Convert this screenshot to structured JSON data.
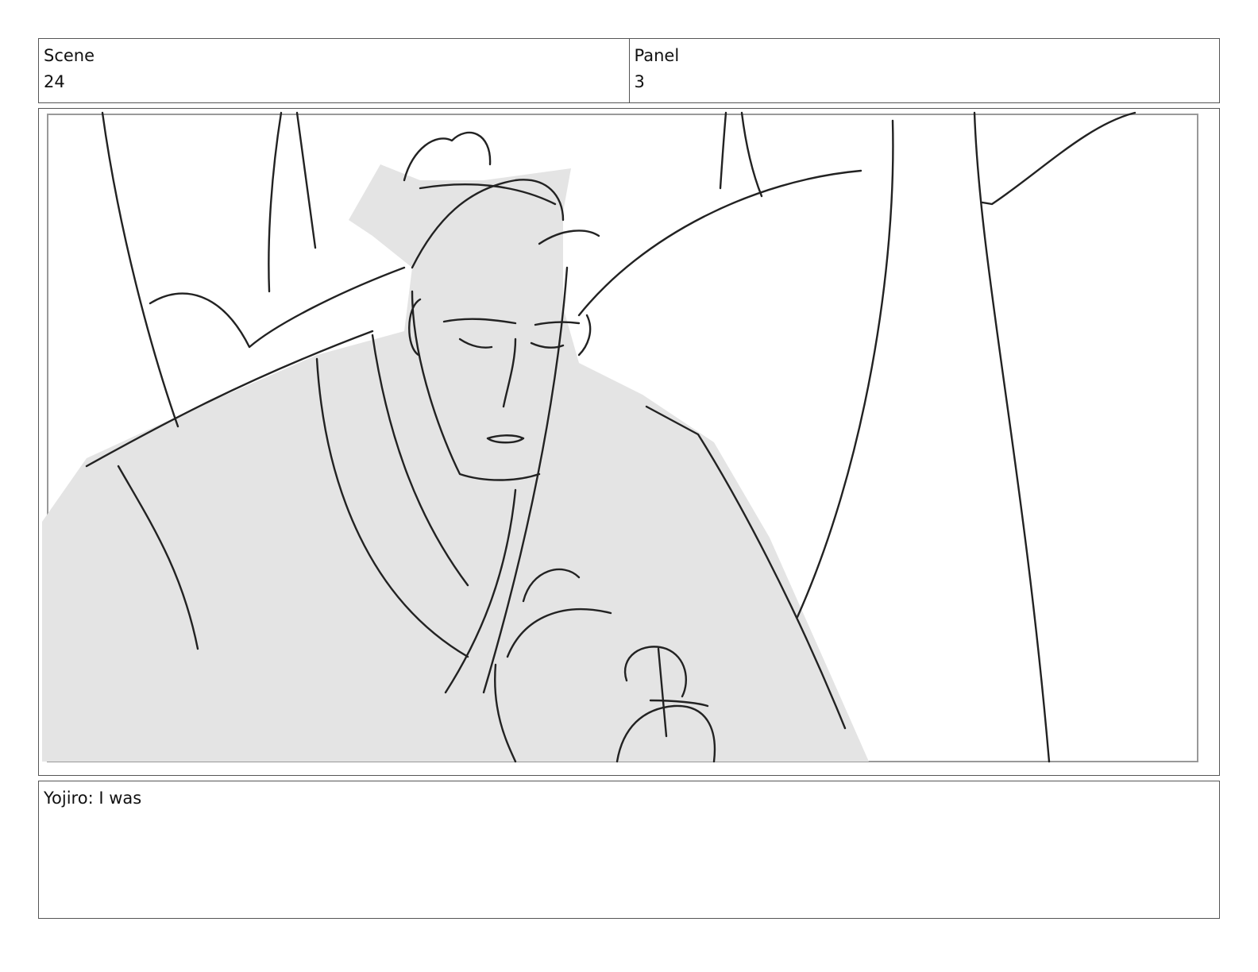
{
  "header": {
    "scene_label": "Scene",
    "scene_value": "24",
    "panel_label": "Panel",
    "panel_value": "3"
  },
  "frame": {
    "image": "storyboard-sketch",
    "fill_color": "#e4e4e4",
    "line_color": "#222222"
  },
  "caption": {
    "text": "Yojiro: I was"
  }
}
